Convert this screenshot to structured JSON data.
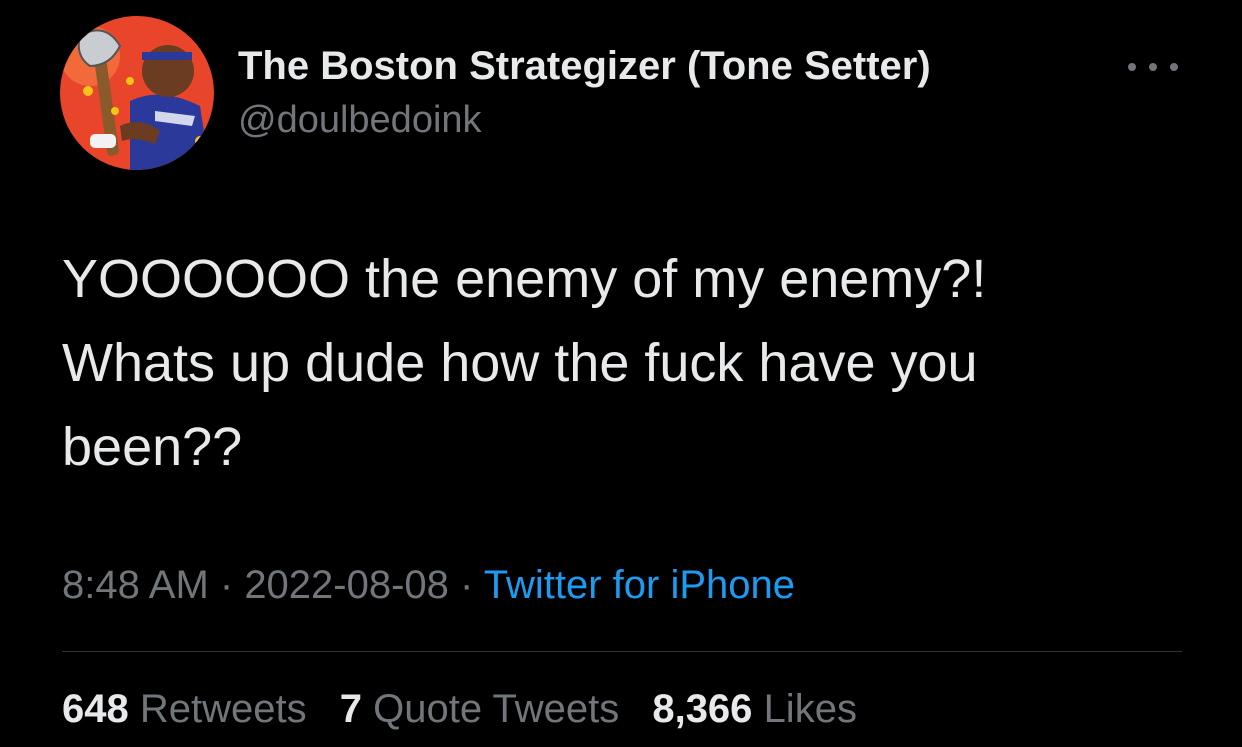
{
  "author": {
    "display_name": "The Boston Strategizer (Tone Setter)",
    "handle": "@doulbedoink",
    "avatar_icon": "cartoon-warrior-with-axe-avatar"
  },
  "tweet": {
    "lines": [
      "YOOOOOO the enemy of my enemy?!",
      "Whats up dude how the fuck have you",
      "been??"
    ]
  },
  "meta": {
    "time": "8:48 AM",
    "sep1": " · ",
    "date": "2022-08-08",
    "sep2": " · ",
    "source": "Twitter for iPhone"
  },
  "stats": {
    "retweets_count": "648",
    "retweets_label": "Retweets",
    "quotes_count": "7",
    "quotes_label": "Quote Tweets",
    "likes_count": "8,366",
    "likes_label": "Likes"
  },
  "colors": {
    "background": "#000000",
    "text_primary": "#e7e9ea",
    "text_secondary": "#71767b",
    "link": "#1d9bf0",
    "divider": "#2f3336"
  }
}
